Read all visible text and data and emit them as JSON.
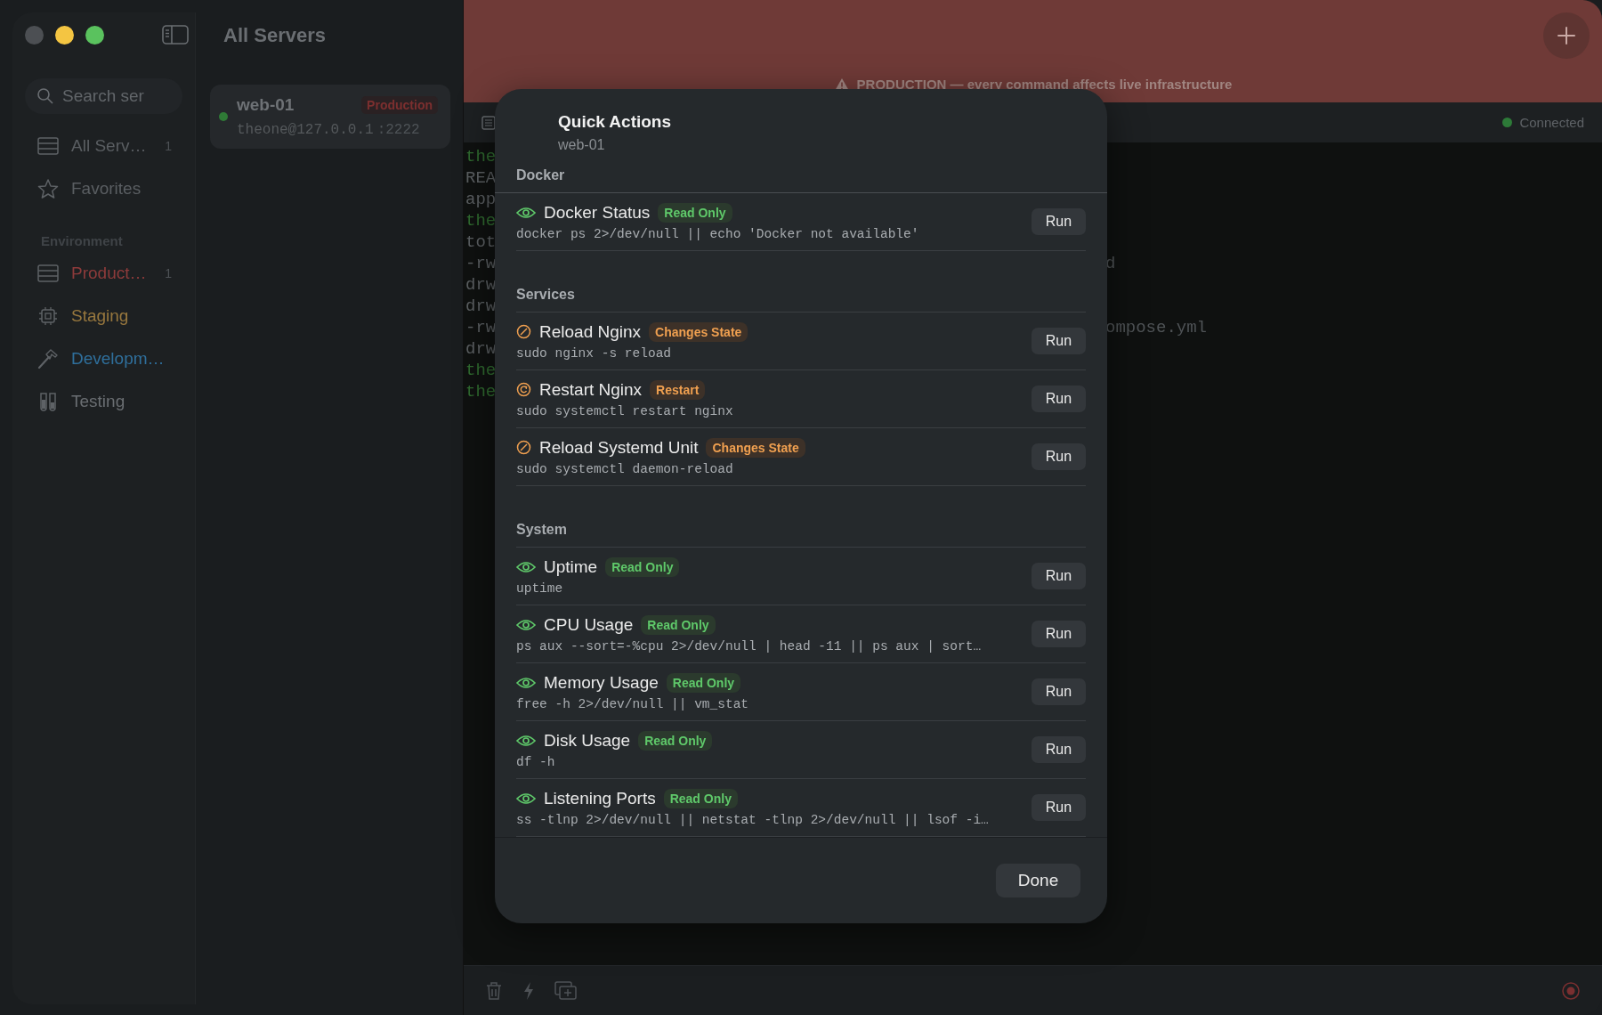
{
  "window": {
    "title": "All Servers"
  },
  "sidebar": {
    "search": {
      "placeholder": "Search ser"
    },
    "items": [
      {
        "label": "All Serv…",
        "count": "1",
        "color": "#5a5e62"
      },
      {
        "label": "Favorites",
        "color": "#5a5e62"
      }
    ],
    "section": "Environment",
    "environments": [
      {
        "label": "Product…",
        "count": "1",
        "color": "#8e3b3b"
      },
      {
        "label": "Staging",
        "color": "#97773e"
      },
      {
        "label": "Developm…",
        "color": "#2f6f9c"
      },
      {
        "label": "Testing",
        "color": "#6a6e72"
      }
    ]
  },
  "servers": [
    {
      "name": "web-01",
      "badge": "Production",
      "address": "theone@127.0.0.1",
      "port": ":2222",
      "online": true,
      "selected": true
    }
  ],
  "banner": {
    "text": "PRODUCTION — every command affects live infrastructure"
  },
  "status": {
    "text": "Connected",
    "connected": true
  },
  "terminal": {
    "lines": [
      {
        "kind": "prompt",
        "left": "the"
      },
      {
        "kind": "output",
        "left": "REA"
      },
      {
        "kind": "output",
        "left": "app"
      },
      {
        "kind": "prompt",
        "left": "the"
      },
      {
        "kind": "output",
        "left": "tot"
      },
      {
        "kind": "output",
        "left": "-rw",
        "right": "d"
      },
      {
        "kind": "output",
        "left": "drw"
      },
      {
        "kind": "output",
        "left": "drw"
      },
      {
        "kind": "output",
        "left": "-rw",
        "right": "ompose.yml"
      },
      {
        "kind": "output",
        "left": "drw"
      },
      {
        "kind": "prompt",
        "left": "the"
      },
      {
        "kind": "prompt",
        "left": "the"
      }
    ]
  },
  "dialog": {
    "title": "Quick Actions",
    "subtitle": "web-01",
    "sections": [
      {
        "name": "Docker",
        "actions": [
          {
            "kind": "readonly",
            "title": "Docker Status",
            "badge": "Read Only",
            "command": "docker ps 2>/dev/null || echo 'Docker not available'",
            "button": "Run"
          }
        ]
      },
      {
        "name": "Services",
        "actions": [
          {
            "kind": "changes",
            "title": "Reload Nginx",
            "badge": "Changes State",
            "command": "sudo nginx -s reload",
            "button": "Run"
          },
          {
            "kind": "restart",
            "title": "Restart Nginx",
            "badge": "Restart",
            "command": "sudo systemctl restart nginx",
            "button": "Run"
          },
          {
            "kind": "changes",
            "title": "Reload Systemd Unit",
            "badge": "Changes State",
            "command": "sudo systemctl daemon-reload",
            "button": "Run"
          }
        ]
      },
      {
        "name": "System",
        "actions": [
          {
            "kind": "readonly",
            "title": "Uptime",
            "badge": "Read Only",
            "command": "uptime",
            "button": "Run"
          },
          {
            "kind": "readonly",
            "title": "CPU Usage",
            "badge": "Read Only",
            "command": "ps aux --sort=-%cpu 2>/dev/null | head -11 || ps aux | sort…",
            "button": "Run"
          },
          {
            "kind": "readonly",
            "title": "Memory Usage",
            "badge": "Read Only",
            "command": "free -h 2>/dev/null || vm_stat",
            "button": "Run"
          },
          {
            "kind": "readonly",
            "title": "Disk Usage",
            "badge": "Read Only",
            "command": "df -h",
            "button": "Run"
          },
          {
            "kind": "readonly",
            "title": "Listening Ports",
            "badge": "Read Only",
            "command": "ss -tlnp 2>/dev/null || netstat -tlnp 2>/dev/null || lsof -i…",
            "button": "Run"
          }
        ]
      }
    ],
    "done": "Done"
  }
}
